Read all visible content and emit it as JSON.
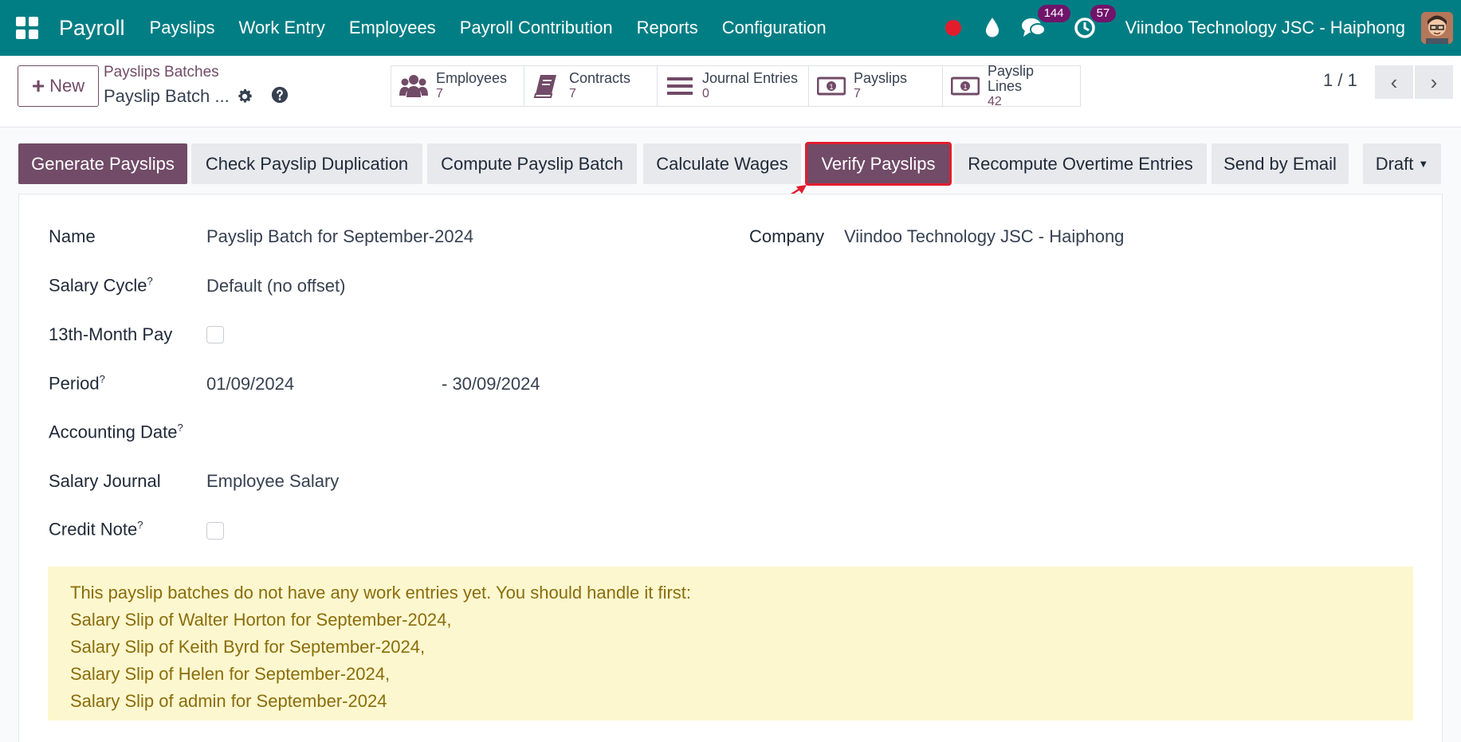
{
  "navbar": {
    "brand": "Payroll",
    "menu": [
      "Payslips",
      "Work Entry",
      "Employees",
      "Payroll Contribution",
      "Reports",
      "Configuration"
    ],
    "messages_count": "144",
    "activities_count": "57",
    "company": "Viindoo Technology JSC - Haiphong"
  },
  "control": {
    "new_label": "New",
    "breadcrumb_parent": "Payslips Batches",
    "breadcrumb_current": "Payslip Batch ...",
    "smart_buttons": [
      {
        "label": "Employees",
        "count": "7",
        "icon": "users-icon"
      },
      {
        "label": "Contracts",
        "count": "7",
        "icon": "book-icon"
      },
      {
        "label": "Journal Entries",
        "count": "0",
        "icon": "list-icon"
      },
      {
        "label": "Payslips",
        "count": "7",
        "icon": "money-icon"
      },
      {
        "label": "Payslip Lines",
        "count": "42",
        "icon": "money-icon"
      }
    ],
    "pager": "1 / 1"
  },
  "actions": {
    "generate": "Generate Payslips",
    "check_dup": "Check Payslip Duplication",
    "compute": "Compute Payslip Batch",
    "calc_wages": "Calculate Wages",
    "verify": "Verify Payslips",
    "recompute_ot": "Recompute Overtime Entries",
    "send_email": "Send by Email",
    "status": "Draft"
  },
  "form": {
    "name_label": "Name",
    "name_value": "Payslip Batch for September-2024",
    "company_label": "Company",
    "company_value": "Viindoo Technology JSC - Haiphong",
    "salary_cycle_label": "Salary Cycle",
    "salary_cycle_value": "Default (no offset)",
    "thirteenth_label": "13th-Month Pay",
    "period_label": "Period",
    "period_from": "01/09/2024",
    "period_to": "- 30/09/2024",
    "accounting_date_label": "Accounting Date",
    "journal_label": "Salary Journal",
    "journal_value": "Employee Salary",
    "credit_note_label": "Credit Note",
    "help_mark": "?"
  },
  "alert": {
    "lines": [
      "This payslip batches do not have any work entries yet. You should handle it first:",
      "Salary Slip of Walter Horton for September-2024,",
      "Salary Slip of Keith Byrd for September-2024,",
      "Salary Slip of Helen for September-2024,",
      "Salary Slip of admin for September-2024"
    ]
  }
}
